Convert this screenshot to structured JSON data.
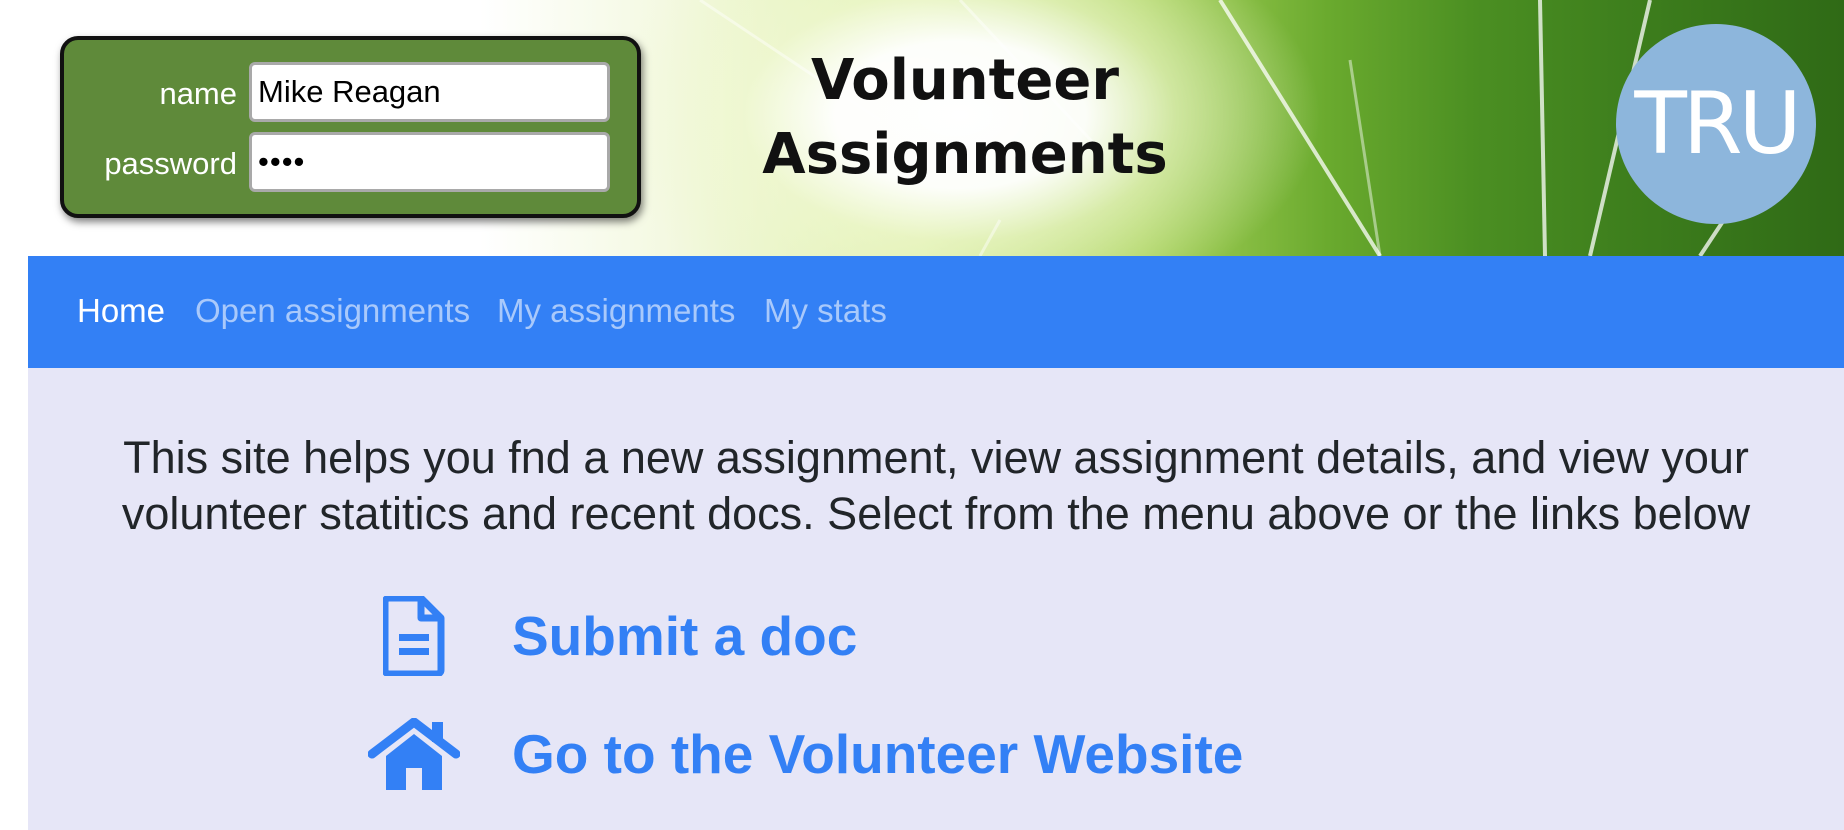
{
  "header": {
    "title_line1": "Volunteer",
    "title_line2": "Assignments",
    "logo_text": "TRU"
  },
  "login": {
    "name_label": "name",
    "name_value": "Mike Reagan",
    "password_label": "password",
    "password_value": "••••"
  },
  "nav": {
    "items": [
      {
        "label": "Home",
        "active": true
      },
      {
        "label": "Open assignments",
        "active": false
      },
      {
        "label": "My assignments",
        "active": false
      },
      {
        "label": "My stats",
        "active": false
      }
    ]
  },
  "main": {
    "intro": "This site helps you fnd a new assignment, view assignment details, and view your volunteer statitics and recent docs. Select from the menu above or the links below",
    "links": [
      {
        "label": "Submit a doc",
        "icon": "document-icon"
      },
      {
        "label": "Go to the Volunteer Website",
        "icon": "home-icon"
      }
    ]
  },
  "colors": {
    "accent": "#3380f5",
    "login_box": "#5f8a3a",
    "content_bg": "#e6e6f7",
    "logo_circle": "#8db6dc"
  }
}
